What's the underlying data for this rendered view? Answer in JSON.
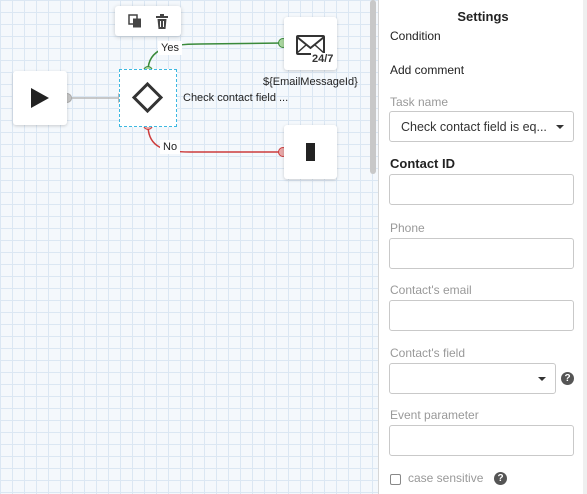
{
  "canvas": {
    "toolbar": {
      "copy_icon": "copy-icon",
      "delete_icon": "trash-icon"
    },
    "nodes": {
      "start": {
        "icon": "play-icon"
      },
      "condition": {
        "icon": "diamond-icon",
        "caption": "Check contact field ..."
      },
      "email": {
        "icon": "envelope-247-icon",
        "badge": "24/7",
        "caption": "${EmailMessageId}"
      },
      "end": {
        "icon": "end-icon"
      }
    },
    "edges": {
      "yes_label": "Yes",
      "no_label": "No",
      "yes_color": "#3a8a3a",
      "no_color": "#cc3b3b",
      "start_color": "#b8b8b8"
    }
  },
  "settings": {
    "title": "Settings",
    "condition_label": "Condition",
    "add_comment": "Add comment",
    "task_name": {
      "label": "Task name",
      "value": "Check contact field is eq..."
    },
    "contact_id": {
      "label": "Contact ID",
      "value": ""
    },
    "phone": {
      "label": "Phone",
      "value": ""
    },
    "contact_email": {
      "label": "Contact's email",
      "value": ""
    },
    "contact_field": {
      "label": "Contact's field",
      "value": ""
    },
    "event_parameter": {
      "label": "Event parameter",
      "value": ""
    },
    "case_sensitive": {
      "label": "case sensitive",
      "checked": false
    },
    "help_glyph": "?"
  }
}
